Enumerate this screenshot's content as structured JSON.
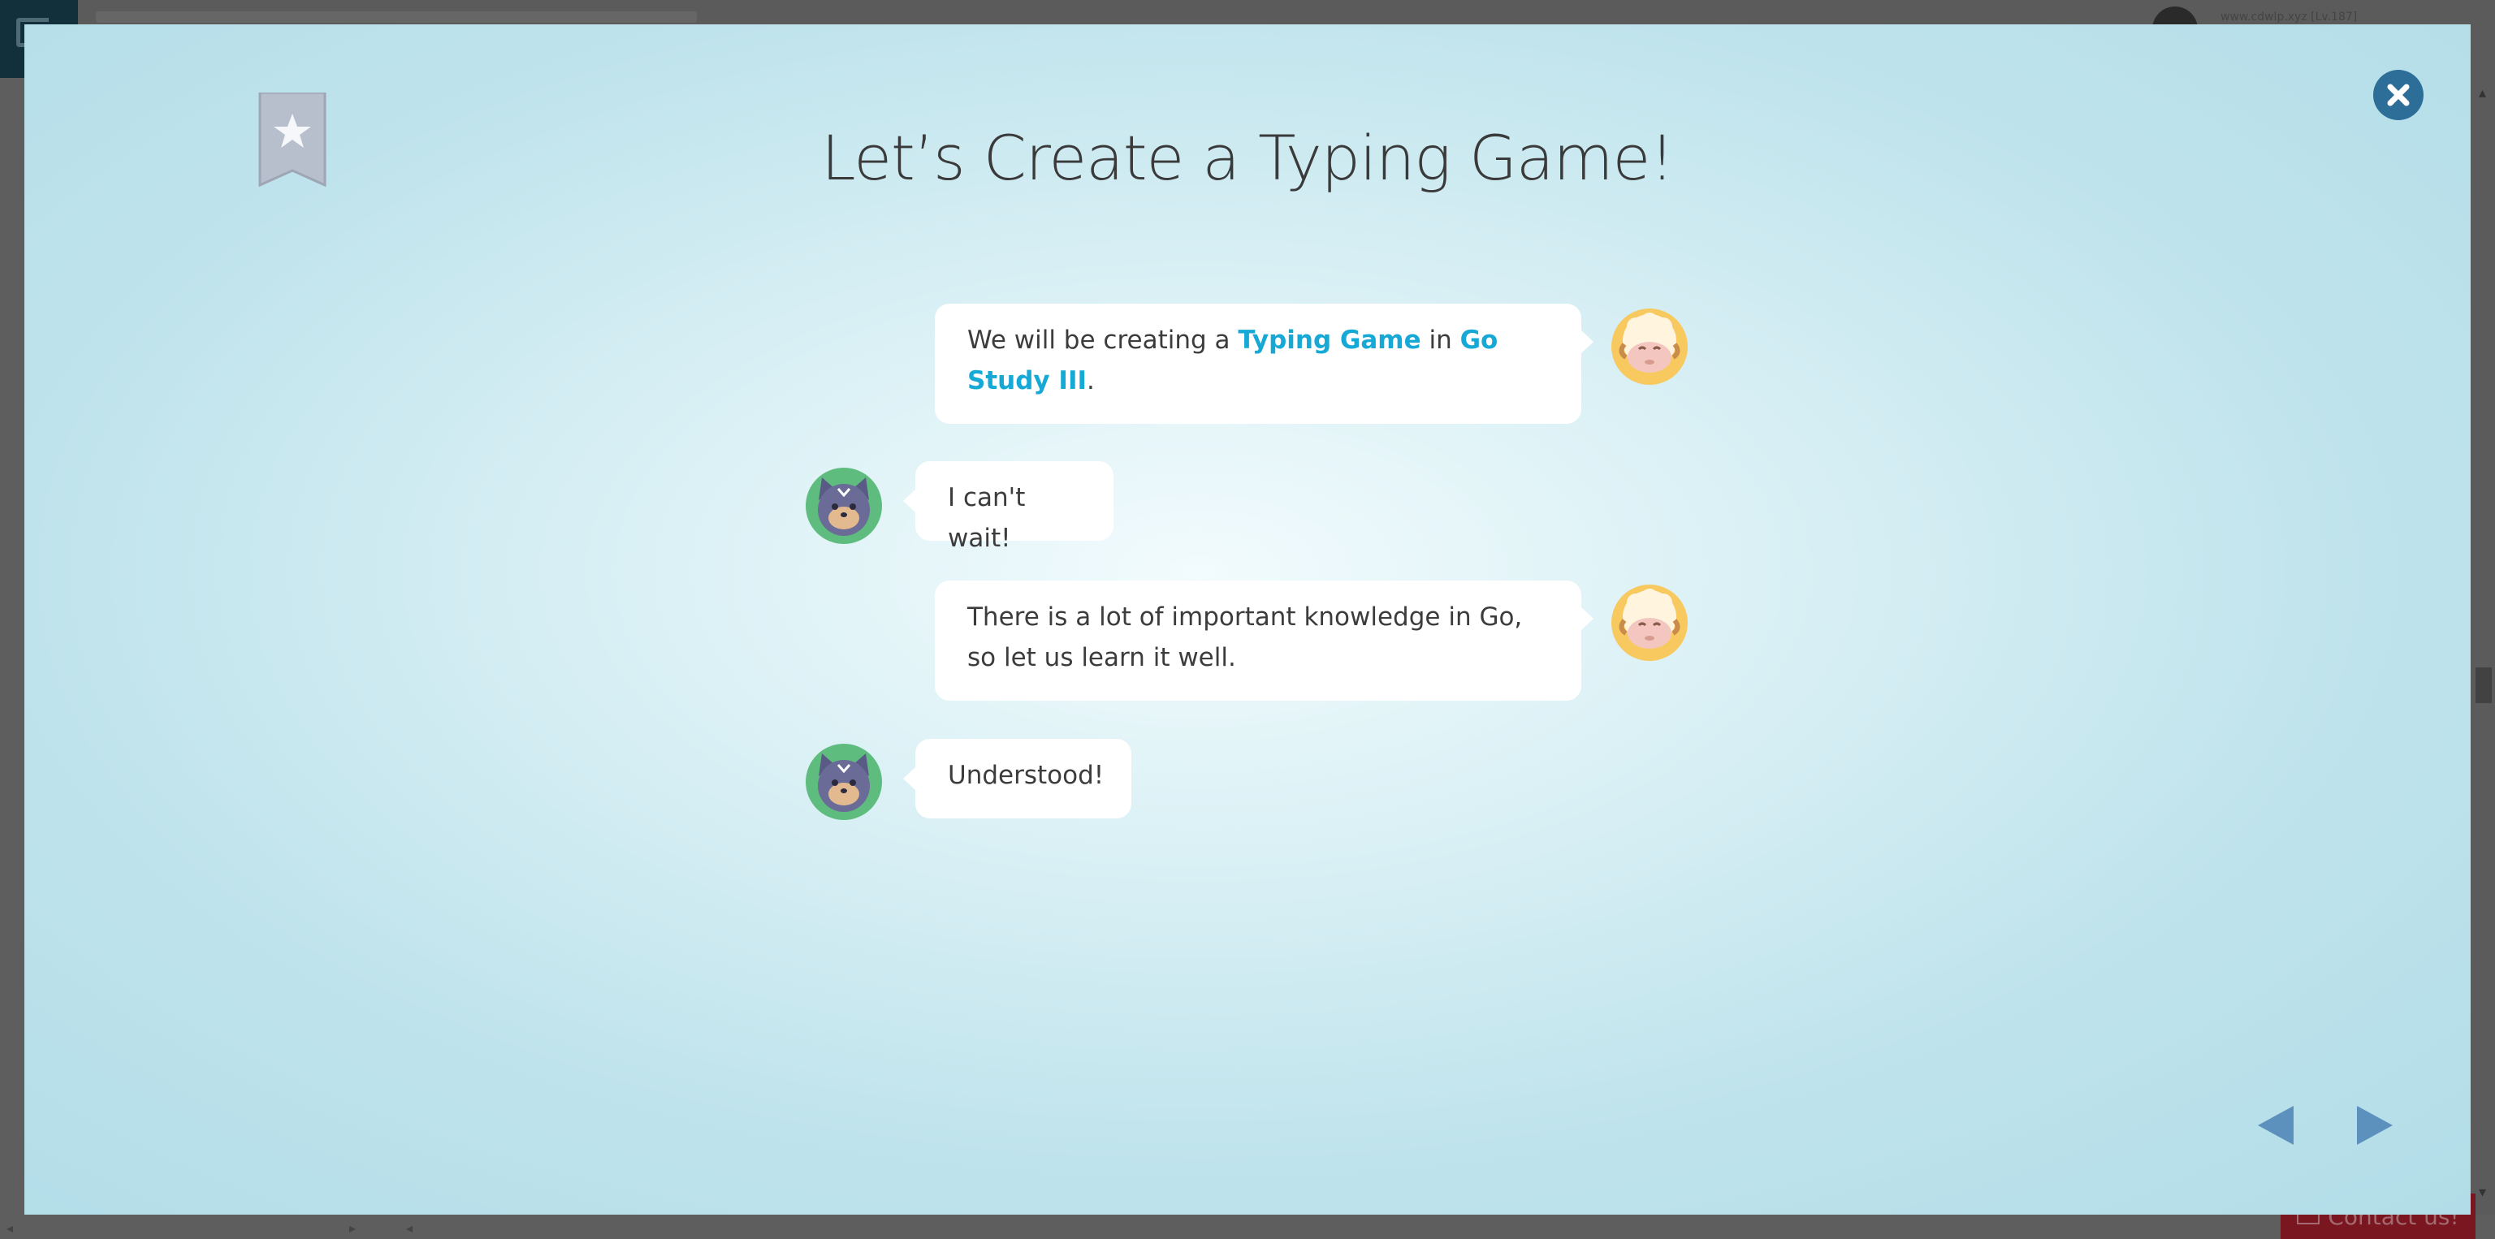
{
  "background": {
    "user_text": "www.cdwlp.xyz [Lv.187]",
    "contact_label": "Contact us!"
  },
  "modal": {
    "title": "Let’s Create a Typing Game!",
    "close_icon": "close-icon",
    "bookmark_icon": "bookmark-star-icon",
    "messages": [
      {
        "speaker": "sheep",
        "side": "right",
        "parts": [
          {
            "text": "We will be creating a "
          },
          {
            "text": "Typing Game",
            "highlight": true
          },
          {
            "text": " in "
          },
          {
            "text": "Go Study III",
            "highlight": true
          },
          {
            "text": "."
          }
        ]
      },
      {
        "speaker": "cat",
        "side": "left",
        "text": "I can't wait!"
      },
      {
        "speaker": "sheep",
        "side": "right",
        "text": "There is a lot of important knowledge in Go, so let us learn it well."
      },
      {
        "speaker": "cat",
        "side": "left",
        "text": "Understood!"
      }
    ],
    "nav": {
      "prev_icon": "prev-arrow-icon",
      "next_icon": "next-arrow-icon"
    }
  },
  "colors": {
    "highlight": "#17a9d6",
    "close_button": "#2d6e98",
    "nav_arrow": "#5d91bd"
  }
}
